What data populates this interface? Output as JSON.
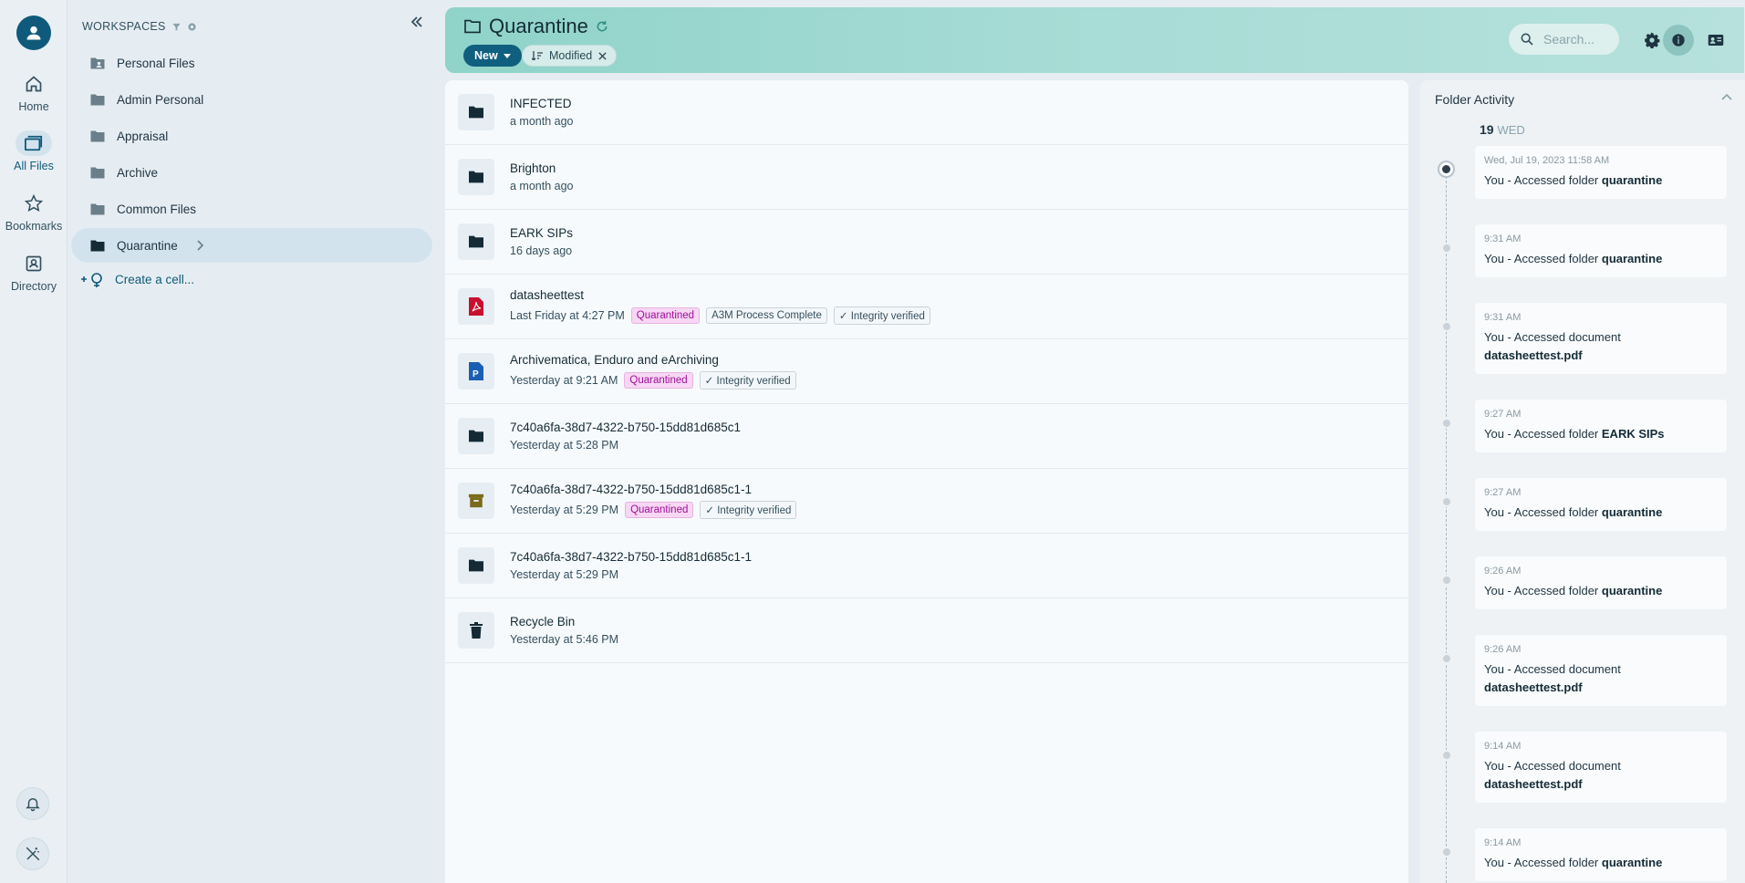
{
  "rail": {
    "items": [
      {
        "label": "Home",
        "icon": "home-icon"
      },
      {
        "label": "All Files",
        "icon": "folders-icon"
      },
      {
        "label": "Bookmarks",
        "icon": "star-icon"
      },
      {
        "label": "Directory",
        "icon": "contact-card-icon"
      }
    ]
  },
  "sidebar": {
    "header": "WORKSPACES",
    "workspaces": [
      {
        "label": "Personal Files",
        "icon": "folder-account-icon"
      },
      {
        "label": "Admin Personal",
        "icon": "folder-icon"
      },
      {
        "label": "Appraisal",
        "icon": "folder-icon"
      },
      {
        "label": "Archive",
        "icon": "folder-icon"
      },
      {
        "label": "Common Files",
        "icon": "folder-icon"
      },
      {
        "label": "Quarantine",
        "icon": "folder-icon",
        "selected": true
      }
    ],
    "create_cell": "Create a cell..."
  },
  "header": {
    "title": "Quarantine",
    "new_label": "New",
    "sort_label": "Modified",
    "search_placeholder": "Search..."
  },
  "files": [
    {
      "name": "INFECTED",
      "meta": "a month ago",
      "type": "folder",
      "tags": []
    },
    {
      "name": "Brighton",
      "meta": "a month ago",
      "type": "folder",
      "tags": []
    },
    {
      "name": "EARK SIPs",
      "meta": "16 days ago",
      "type": "folder",
      "tags": []
    },
    {
      "name": "datasheettest",
      "meta": "Last Friday at 4:27 PM",
      "type": "pdf",
      "tags": [
        "Quarantined",
        "A3M Process Complete",
        "✓ Integrity verified"
      ]
    },
    {
      "name": "Archivematica, Enduro and eArchiving",
      "meta": "Yesterday at 9:21 AM",
      "type": "presentation",
      "tags": [
        "Quarantined",
        "✓ Integrity verified"
      ]
    },
    {
      "name": "7c40a6fa-38d7-4322-b750-15dd81d685c1",
      "meta": "Yesterday at 5:28 PM",
      "type": "folder",
      "tags": []
    },
    {
      "name": "7c40a6fa-38d7-4322-b750-15dd81d685c1-1",
      "meta": "Yesterday at 5:29 PM",
      "type": "archive",
      "tags": [
        "Quarantined",
        "✓ Integrity verified"
      ]
    },
    {
      "name": "7c40a6fa-38d7-4322-b750-15dd81d685c1-1",
      "meta": "Yesterday at 5:29 PM",
      "type": "folder",
      "tags": []
    },
    {
      "name": "Recycle Bin",
      "meta": "Yesterday at 5:46 PM",
      "type": "trash",
      "tags": []
    }
  ],
  "activity": {
    "title": "Folder Activity",
    "day_num": "19",
    "day_name": "WED",
    "events": [
      {
        "time": "Wed, Jul 19, 2023 11:58 AM",
        "text": "You - Accessed folder ",
        "target": "quarantine"
      },
      {
        "time": "9:31 AM",
        "text": "You - Accessed folder ",
        "target": "quarantine"
      },
      {
        "time": "9:31 AM",
        "text": "You - Accessed document ",
        "target": "datasheettest.pdf"
      },
      {
        "time": "9:27 AM",
        "text": "You - Accessed folder ",
        "target": "EARK SIPs"
      },
      {
        "time": "9:27 AM",
        "text": "You - Accessed folder ",
        "target": "quarantine"
      },
      {
        "time": "9:26 AM",
        "text": "You - Accessed folder ",
        "target": "quarantine"
      },
      {
        "time": "9:26 AM",
        "text": "You - Accessed document ",
        "target": "datasheettest.pdf"
      },
      {
        "time": "9:14 AM",
        "text": "You - Accessed document ",
        "target": "datasheettest.pdf"
      },
      {
        "time": "9:14 AM",
        "text": "You - Accessed folder ",
        "target": "quarantine"
      }
    ]
  },
  "colors": {
    "accent": "#105f7f",
    "header_gradient_start": "#8fd3c9",
    "quarantined_bg": "#f7d7f4",
    "quarantined_text": "#a0109a",
    "pdf_red": "#c8102e",
    "presentation_blue": "#1a5fb4",
    "archive_olive": "#7a6a1a"
  }
}
